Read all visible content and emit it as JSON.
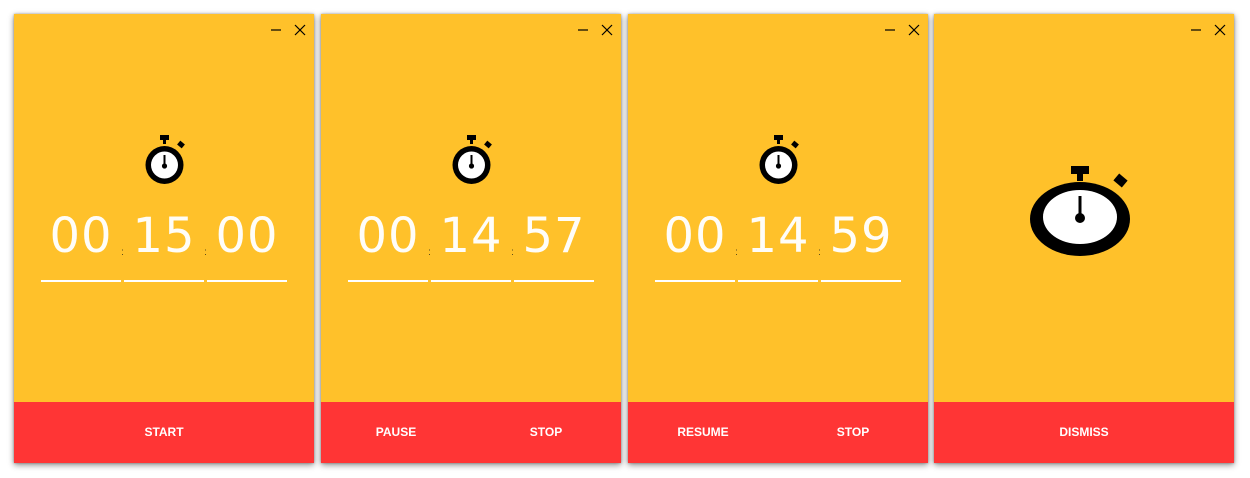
{
  "colors": {
    "window_bg": "#FFC12A",
    "button_bar": "#FF3535",
    "text": "#FFFFFF",
    "icon": "#000000"
  },
  "icons": {
    "minimize": "minimize-icon",
    "close": "close-icon",
    "stopwatch": "stopwatch-icon"
  },
  "windows": [
    {
      "state": "idle",
      "timer": {
        "hours": "00",
        "minutes": "15",
        "seconds": "00",
        "separator": ":"
      },
      "buttons": [
        "START"
      ]
    },
    {
      "state": "running",
      "timer": {
        "hours": "00",
        "minutes": "14",
        "seconds": "57",
        "separator": ":"
      },
      "buttons": [
        "PAUSE",
        "STOP"
      ]
    },
    {
      "state": "paused",
      "timer": {
        "hours": "00",
        "minutes": "14",
        "seconds": "59",
        "separator": ":"
      },
      "buttons": [
        "RESUME",
        "STOP"
      ]
    },
    {
      "state": "finished",
      "buttons": [
        "DISMISS"
      ]
    }
  ]
}
